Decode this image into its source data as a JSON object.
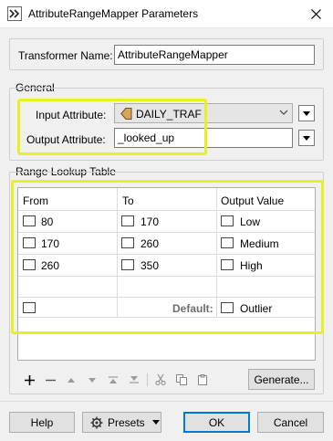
{
  "window": {
    "title": "AttributeRangeMapper Parameters"
  },
  "transformer": {
    "label": "Transformer Name:",
    "value": "AttributeRangeMapper"
  },
  "general": {
    "group_label": "General",
    "input_label": "Input Attribute:",
    "input_value": "DAILY_TRAF",
    "output_label": "Output Attribute:",
    "output_value": "_looked_up"
  },
  "range_table": {
    "group_label": "Range Lookup Table",
    "columns": [
      "From",
      "To",
      "Output Value"
    ],
    "rows": [
      [
        "80",
        "170",
        "Low"
      ],
      [
        "170",
        "260",
        "Medium"
      ],
      [
        "260",
        "350",
        "High"
      ]
    ],
    "default_label": "Default:",
    "default_value": "Outlier"
  },
  "toolbar": {
    "generate_label": "Generate..."
  },
  "buttons": {
    "help": "Help",
    "presets": "Presets",
    "ok": "OK",
    "cancel": "Cancel"
  },
  "colors": {
    "highlight": "#e5f125",
    "accent": "#0078d7"
  }
}
